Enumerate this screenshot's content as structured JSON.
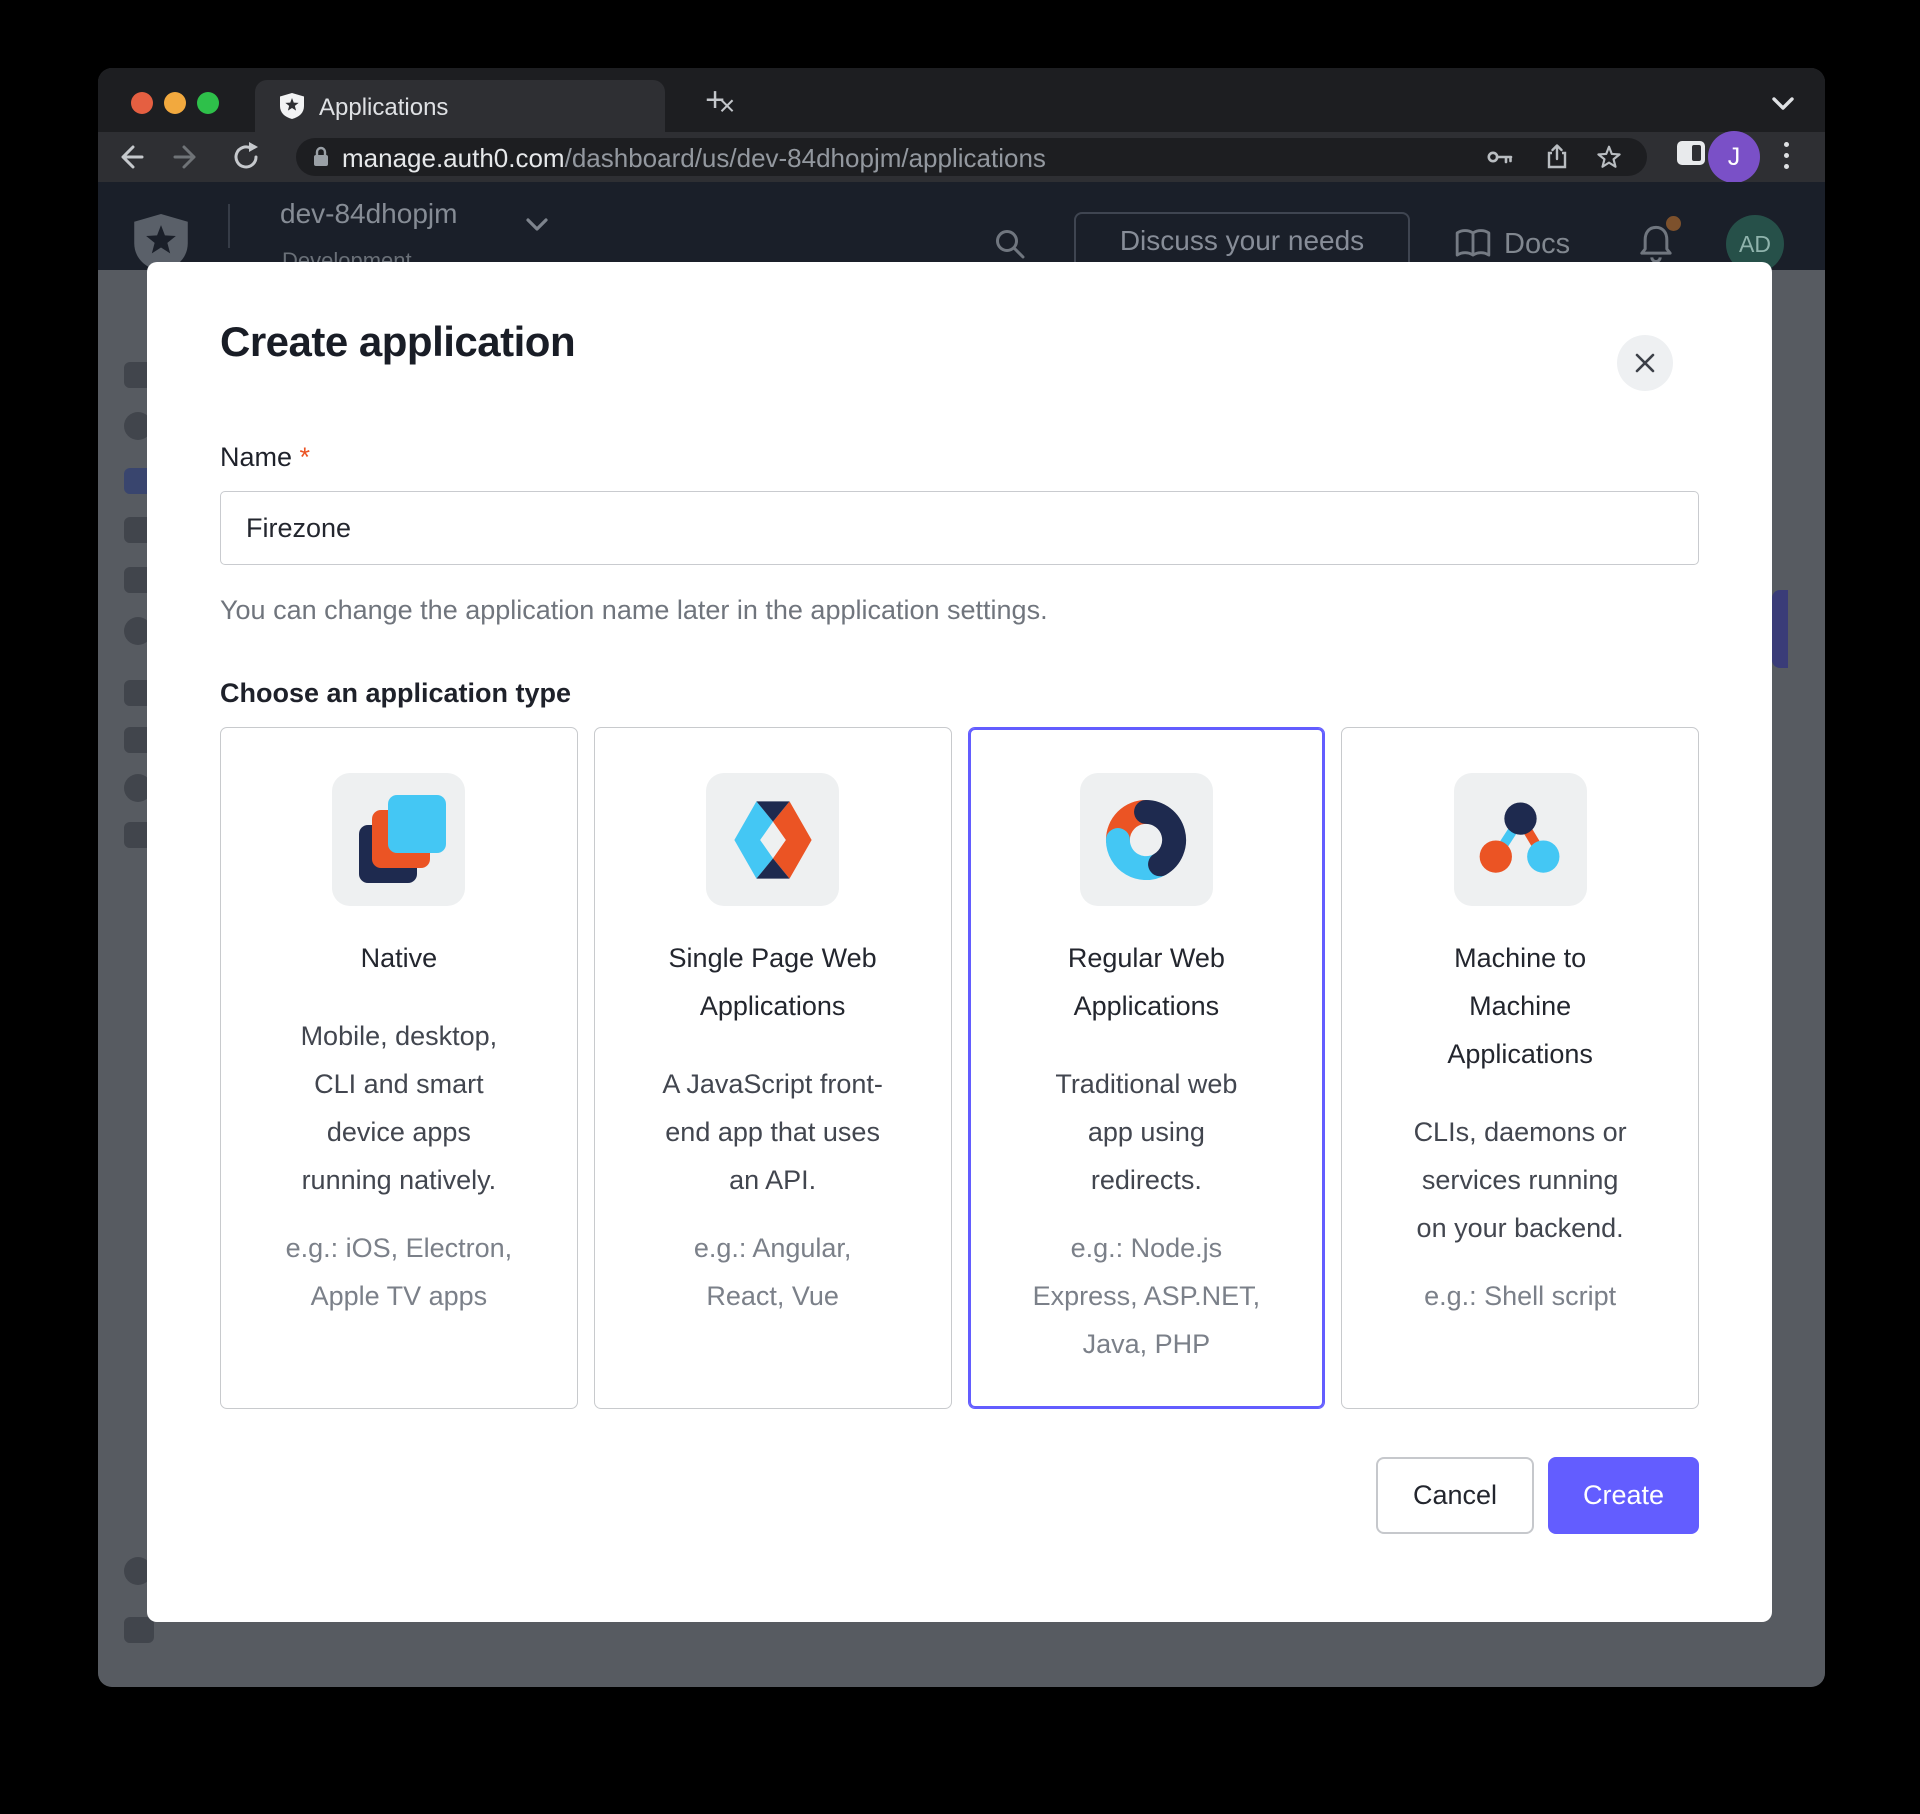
{
  "browser": {
    "tab_title": "Applications",
    "tab_close": "×",
    "new_tab_label": "+",
    "url_host": "manage.auth0.com",
    "url_path": "/dashboard/us/dev-84dhopjm/applications",
    "profile_initial": "J"
  },
  "dashboard_header": {
    "tenant": "dev-84dhopjm",
    "tenant_sub_partial": "Development",
    "discuss_button": "Discuss your needs",
    "docs_label": "Docs",
    "avatar_initials": "AD"
  },
  "modal": {
    "title": "Create application",
    "name_label": "Name",
    "required_mark": "*",
    "name_value": "Firezone",
    "name_help": "You can change the application name later in the application settings.",
    "type_heading": "Choose an application type",
    "cards": [
      {
        "icon": "native-stack-icon",
        "selected": false,
        "title_lines": [
          "Native"
        ],
        "desc_lines": [
          "Mobile, desktop,",
          "CLI and smart",
          "device apps",
          "running natively."
        ],
        "eg_lines": [
          "e.g.: iOS, Electron,",
          "Apple TV apps"
        ]
      },
      {
        "icon": "spa-diamond-icon",
        "selected": false,
        "title_lines": [
          "Single Page Web",
          "Applications"
        ],
        "desc_lines": [
          "A JavaScript front-",
          "end app that uses",
          "an API."
        ],
        "eg_lines": [
          "e.g.: Angular,",
          "React, Vue"
        ]
      },
      {
        "icon": "regular-web-swirl-icon",
        "selected": true,
        "title_lines": [
          "Regular Web",
          "Applications"
        ],
        "desc_lines": [
          "Traditional web",
          "app using",
          "redirects."
        ],
        "eg_lines": [
          "e.g.: Node.js",
          "Express, ASP.NET,",
          "Java, PHP"
        ]
      },
      {
        "icon": "m2m-nodes-icon",
        "selected": false,
        "title_lines": [
          "Machine to",
          "Machine",
          "Applications"
        ],
        "desc_lines": [
          "CLIs, daemons or",
          "services running",
          "on your backend."
        ],
        "eg_lines": [
          "e.g.: Shell script"
        ]
      }
    ],
    "cancel_label": "Cancel",
    "create_label": "Create"
  },
  "colors": {
    "accent_indigo": "#635dff",
    "brand_orange": "#eb5424",
    "brand_navy": "#1e2a4f",
    "brand_light_blue": "#44c7f4",
    "required_mark": "#eb5424"
  }
}
